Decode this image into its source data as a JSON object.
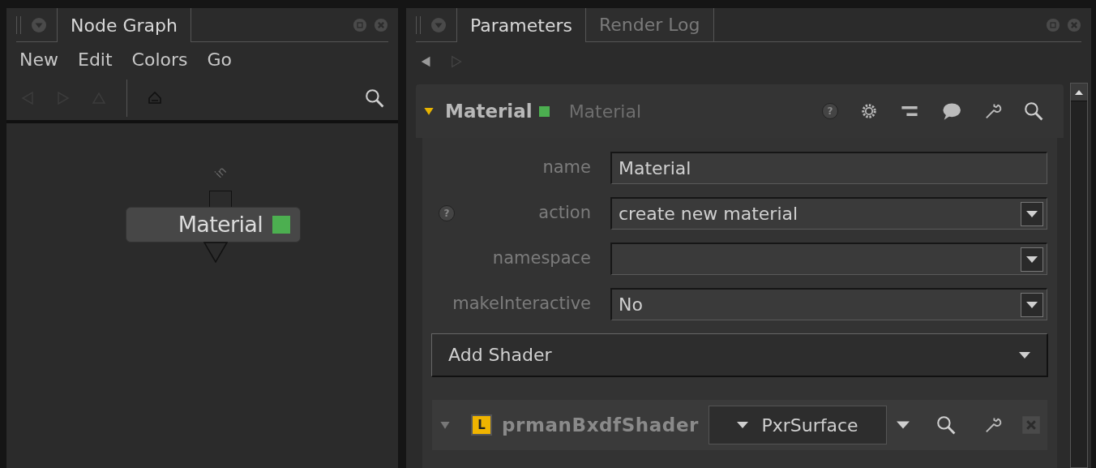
{
  "node_graph": {
    "tabs": [
      {
        "label": "Node Graph",
        "selected": true
      }
    ],
    "menu": [
      "New",
      "Edit",
      "Colors",
      "Go"
    ],
    "node": {
      "name": "Material",
      "input_port": "in"
    }
  },
  "parameters": {
    "tabs": [
      {
        "label": "Parameters",
        "selected": true
      },
      {
        "label": "Render Log",
        "selected": false
      }
    ],
    "node_header": {
      "name": "Material",
      "type": "Material",
      "expanded": true,
      "help": "?"
    },
    "fields": [
      {
        "label": "name",
        "kind": "text",
        "value": "Material"
      },
      {
        "label": "action",
        "kind": "dropdown",
        "value": "create new material",
        "help": "?"
      },
      {
        "label": "namespace",
        "kind": "dropdown"
      },
      {
        "label": "makeInteractive",
        "kind": "dropdown",
        "value": "No"
      }
    ],
    "add_shader": "Add Shader",
    "shader": {
      "name": "prmanBxdfShader",
      "badge": "L",
      "value": "PxrSurface",
      "expanded": true
    }
  }
}
